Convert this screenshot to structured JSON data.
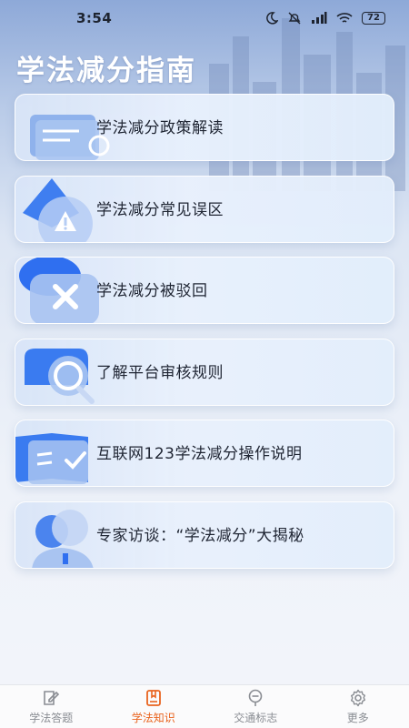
{
  "status_bar": {
    "time": "3:54",
    "battery": "72",
    "icons": [
      "moon-icon",
      "mute-icon",
      "hd-signal-icon",
      "wifi-icon",
      "battery-icon"
    ]
  },
  "page": {
    "title": "学法减分指南"
  },
  "menu": [
    {
      "label": "学法减分政策解读",
      "icon": "document-icon"
    },
    {
      "label": "学法减分常见误区",
      "icon": "warning-icon"
    },
    {
      "label": "学法减分被驳回",
      "icon": "close-icon"
    },
    {
      "label": "了解平台审核规则",
      "icon": "magnifier-icon"
    },
    {
      "label": "互联网123学法减分操作说明",
      "icon": "book-check-icon"
    },
    {
      "label": "专家访谈：“学法减分”大揭秘",
      "icon": "expert-icon"
    }
  ],
  "tabbar": {
    "active_color": "#e9641f",
    "inactive_color": "#8a8d93",
    "items": [
      {
        "label": "学法答题",
        "icon": "edit-icon",
        "active": false
      },
      {
        "label": "学法知识",
        "icon": "book-icon",
        "active": true
      },
      {
        "label": "交通标志",
        "icon": "sign-icon",
        "active": false
      },
      {
        "label": "更多",
        "icon": "gear-icon",
        "active": false
      }
    ]
  }
}
